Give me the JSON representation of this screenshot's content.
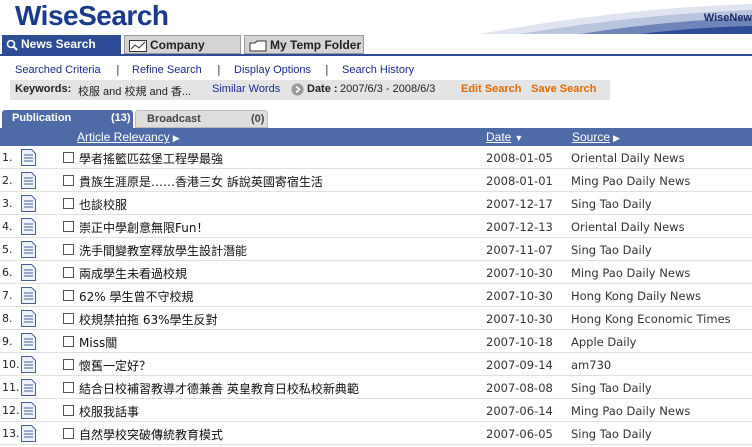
{
  "header": {
    "logo": "WiseSearch",
    "brand_right": "WiseNew"
  },
  "tabs": [
    {
      "label": "News Search",
      "active": true,
      "icon": "magnifier-icon"
    },
    {
      "label": "Company Search",
      "active": false,
      "icon": "chart-icon"
    },
    {
      "label": "My Temp Folder",
      "active": false,
      "icon": "folder-icon"
    }
  ],
  "subnav": {
    "items": [
      "Searched Criteria",
      "Refine Search",
      "Display Options",
      "Search History"
    ],
    "separator": "|"
  },
  "keywords": {
    "label": "Keywords:",
    "value": "校服 and 校規 and 香...",
    "similar": "Similar Words",
    "date_label": "Date :",
    "date_value": "2007/6/3 - 2008/6/3",
    "edit": "Edit Search",
    "save": "Save Search"
  },
  "pubtabs": {
    "publication": {
      "label": "Publication",
      "count": "(13)"
    },
    "broadcast": {
      "label": "Broadcast",
      "count": "(0)"
    }
  },
  "columns": {
    "relevancy": "Article Relevancy",
    "date": "Date",
    "source": "Source"
  },
  "rows": [
    {
      "num": "1.",
      "title": "學者搖籃匹茲堡工程學最強",
      "date": "2008-01-05",
      "source": "Oriental Daily News"
    },
    {
      "num": "2.",
      "title": "貴族生涯原是……香港三女 訴說英國寄宿生活",
      "date": "2008-01-01",
      "source": "Ming Pao Daily News"
    },
    {
      "num": "3.",
      "title": "也談校服",
      "date": "2007-12-17",
      "source": "Sing Tao Daily"
    },
    {
      "num": "4.",
      "title": "崇正中學創意無限Fun！",
      "date": "2007-12-13",
      "source": "Oriental Daily News"
    },
    {
      "num": "5.",
      "title": "洗手間變教室釋放學生設計潛能",
      "date": "2007-11-07",
      "source": "Sing Tao Daily"
    },
    {
      "num": "6.",
      "title": "兩成學生未看過校規",
      "date": "2007-10-30",
      "source": "Ming Pao Daily News"
    },
    {
      "num": "7.",
      "title": "62% 學生曾不守校規",
      "date": "2007-10-30",
      "source": "Hong Kong Daily News"
    },
    {
      "num": "8.",
      "title": "校規禁拍拖 63%學生反對",
      "date": "2007-10-30",
      "source": "Hong Kong Economic Times"
    },
    {
      "num": "9.",
      "title": "Miss關",
      "date": "2007-10-18",
      "source": "Apple Daily"
    },
    {
      "num": "10.",
      "title": "懷舊一定好？",
      "date": "2007-09-14",
      "source": "am730"
    },
    {
      "num": "11.",
      "title": "結合日校補習教導才德兼善 英皇教育日校私校新典範",
      "date": "2007-08-08",
      "source": "Sing Tao Daily"
    },
    {
      "num": "12.",
      "title": "校服我話事",
      "date": "2007-06-14",
      "source": "Ming Pao Daily News"
    },
    {
      "num": "13.",
      "title": "自然學校突破傳統教育模式",
      "date": "2007-06-05",
      "source": "Sing Tao Daily"
    }
  ]
}
